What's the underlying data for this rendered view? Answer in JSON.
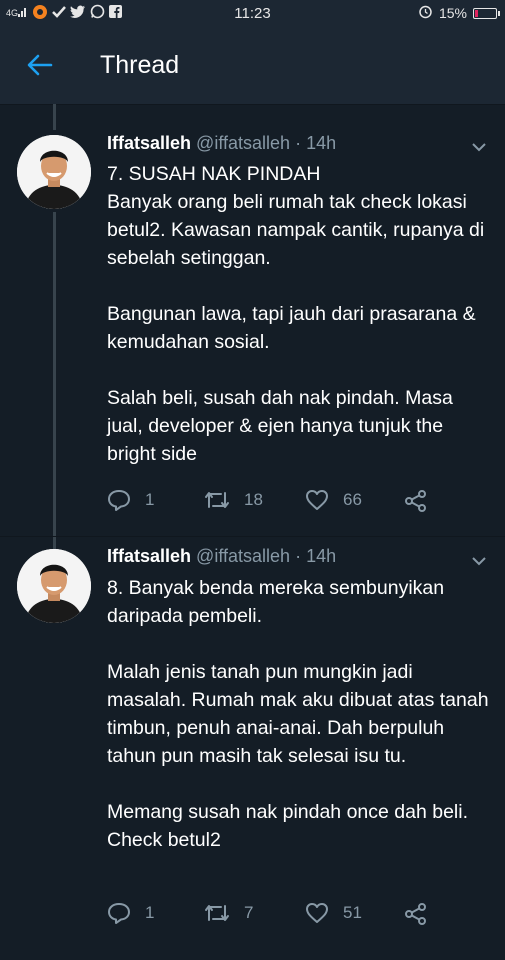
{
  "status_bar": {
    "time": "11:23",
    "battery": "15%",
    "battery_level": 0.15,
    "battery_color": "#e0245e",
    "icons": [
      "signal-icon",
      "app-icon",
      "check-icon",
      "twitter-icon",
      "whatsapp-icon",
      "facebook-icon",
      "alarm-icon",
      "battery-icon"
    ]
  },
  "header": {
    "title": "Thread",
    "back_icon": "arrow-left-icon",
    "accent": "#1da1f2"
  },
  "tweets": [
    {
      "name": "Iffatsalleh",
      "handle": "@iffatsalleh",
      "time": "14h",
      "paragraphs": [
        "7. SUSAH NAK PINDAH\nBanyak orang beli rumah tak check lokasi betul2. Kawasan nampak cantik, rupanya di sebelah setinggan.",
        "Bangunan lawa, tapi jauh dari prasarana & kemudahan sosial.",
        "Salah beli, susah dah nak pindah. Masa jual, developer & ejen hanya tunjuk the bright side"
      ],
      "replies": "1",
      "retweets": "18",
      "likes": "66"
    },
    {
      "name": "Iffatsalleh",
      "handle": "@iffatsalleh",
      "time": "14h",
      "paragraphs": [
        "8. Banyak benda mereka sembunyikan daripada pembeli.",
        "Malah jenis tanah pun mungkin jadi masalah. Rumah mak aku dibuat atas tanah timbun, penuh anai-anai. Dah berpuluh tahun pun masih tak selesai isu tu.",
        "Memang susah nak pindah once dah beli. Check betul2"
      ],
      "replies": "1",
      "retweets": "7",
      "likes": "51"
    }
  ]
}
